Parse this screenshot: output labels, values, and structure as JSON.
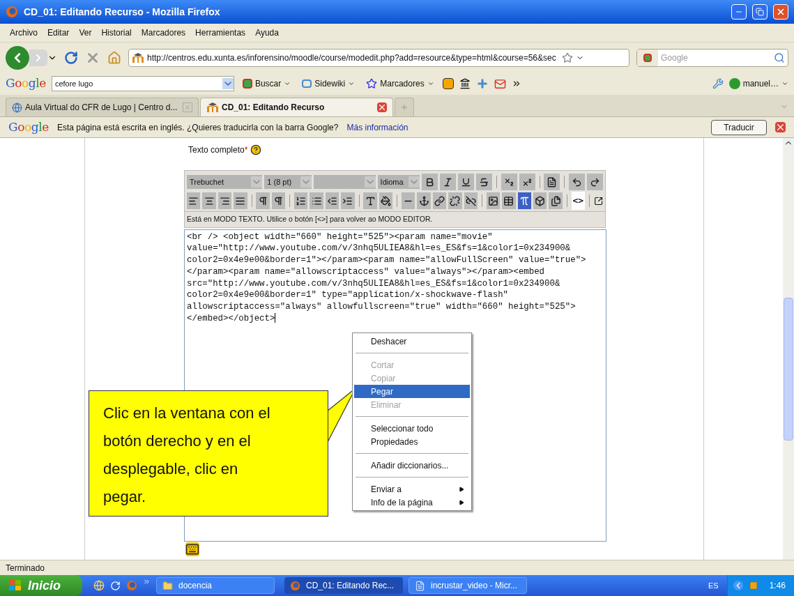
{
  "window": {
    "title": "CD_01: Editando Recurso - Mozilla Firefox"
  },
  "menu_bar": [
    "Archivo",
    "Editar",
    "Ver",
    "Historial",
    "Marcadores",
    "Herramientas",
    "Ayuda"
  ],
  "navigation": {
    "url": "http://centros.edu.xunta.es/inforensino/moodle/course/modedit.php?add=resource&type=html&course=56&sec",
    "search_placeholder": "Google"
  },
  "google_toolbar": {
    "logo": "Google",
    "search_value": "cefore lugo",
    "buttons": [
      "Buscar",
      "Sidewiki",
      "Marcadores"
    ],
    "account": "manuel…"
  },
  "tabs": [
    {
      "label": "Aula Virtual do CFR de Lugo | Centro d...",
      "selected": false
    },
    {
      "label": "CD_01: Editando Recurso",
      "selected": true
    }
  ],
  "translate_bar": {
    "logo": "Google",
    "message": "Esta página está escrita en inglés. ¿Quieres traducirla con la barra Google?",
    "link": "Más información",
    "button": "Traducir"
  },
  "form": {
    "label": "Texto completo",
    "required_mark": "*"
  },
  "editor": {
    "font": "Trebuchet",
    "size": "1 (8 pt)",
    "language": "Idioma",
    "formula_button": {
      "selected": true
    },
    "html_toggle": {
      "label": "<>",
      "selected": true
    },
    "mode_notice": "Está en MODO TEXTO. Utilice o botón [<>] para volver ao MODO EDITOR.",
    "source_lines": [
      "<br /> <object width=\"660\" height=\"525\"><param name=\"movie\"",
      "value=\"http://www.youtube.com/v/3nhq5ULIEA8&hl=es_ES&fs=1&color1=0x234900&",
      "color2=0x4e9e00&border=1\"></param><param name=\"allowFullScreen\" value=\"true\">",
      "</param><param name=\"allowscriptaccess\" value=\"always\"></param><embed",
      "src=\"http://www.youtube.com/v/3nhq5ULIEA8&hl=es_ES&fs=1&color1=0x234900&",
      "color2=0x4e9e00&border=1\" type=\"application/x-shockwave-flash\"",
      "allowscriptaccess=\"always\" allowfullscreen=\"true\" width=\"660\" height=\"525\">",
      "</embed></object>"
    ]
  },
  "context_menu": [
    {
      "kind": "item",
      "label": "Deshacer",
      "disabled": false,
      "selected": false,
      "submenu": false
    },
    {
      "kind": "separator"
    },
    {
      "kind": "item",
      "label": "Cortar",
      "disabled": true,
      "selected": false,
      "submenu": false
    },
    {
      "kind": "item",
      "label": "Copiar",
      "disabled": true,
      "selected": false,
      "submenu": false
    },
    {
      "kind": "item",
      "label": "Pegar",
      "disabled": false,
      "selected": true,
      "submenu": false
    },
    {
      "kind": "item",
      "label": "Eliminar",
      "disabled": true,
      "selected": false,
      "submenu": false
    },
    {
      "kind": "separator"
    },
    {
      "kind": "item",
      "label": "Seleccionar todo",
      "disabled": false,
      "selected": false,
      "submenu": false
    },
    {
      "kind": "item",
      "label": "Propiedades",
      "disabled": false,
      "selected": false,
      "submenu": false
    },
    {
      "kind": "separator"
    },
    {
      "kind": "item",
      "label": "Añadir diccionarios...",
      "disabled": false,
      "selected": false,
      "submenu": false
    },
    {
      "kind": "separator"
    },
    {
      "kind": "item",
      "label": "Enviar a",
      "disabled": false,
      "selected": false,
      "submenu": true
    },
    {
      "kind": "item",
      "label": "Info de la página",
      "disabled": false,
      "selected": false,
      "submenu": true
    }
  ],
  "callout": {
    "lines": [
      "Clic en la ventana con el",
      "botón derecho y en el",
      "desplegable, clic en",
      "pegar."
    ]
  },
  "status_bar": "Terminado",
  "taskbar": {
    "start": "Inicio",
    "tasks": [
      {
        "label": "docencia",
        "kind": "folder",
        "selected": false
      },
      {
        "label": "CD_01: Editando Rec...",
        "kind": "browser",
        "selected": true
      },
      {
        "label": "incrustar_video - Micr...",
        "kind": "document",
        "selected": false
      }
    ],
    "language": "ES",
    "clock": "1:46"
  }
}
